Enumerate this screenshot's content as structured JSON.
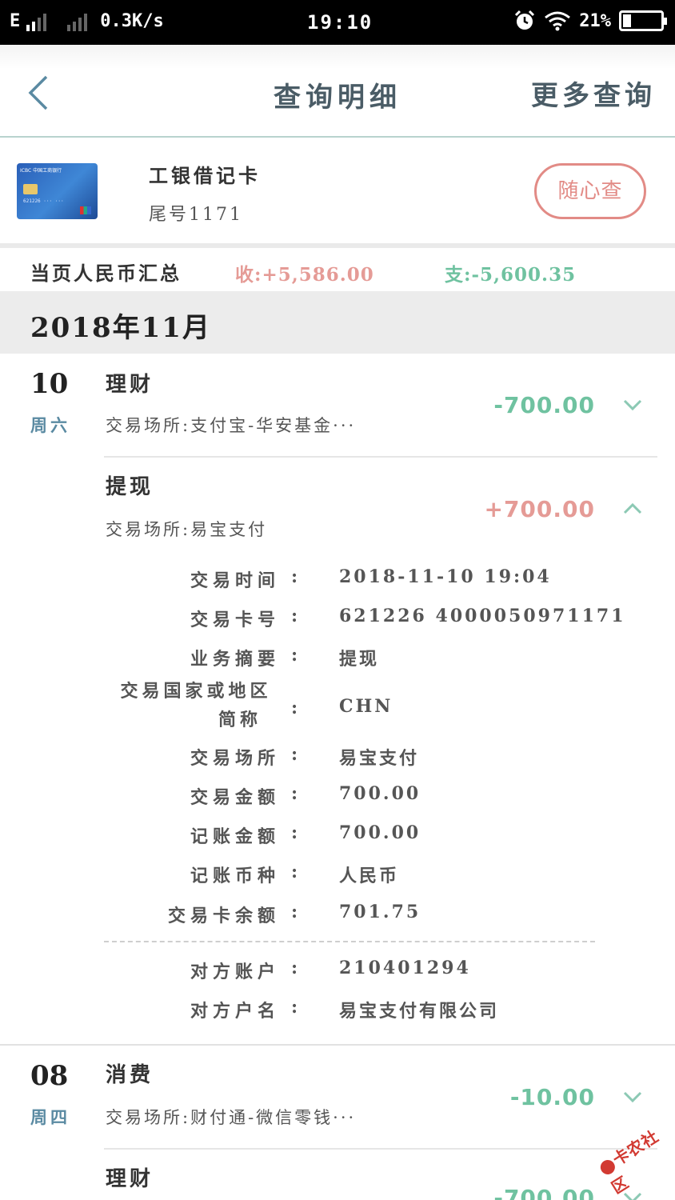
{
  "status_bar": {
    "network": "E",
    "speed": "0.3K/s",
    "time": "19:10",
    "battery": "21%",
    "battery_level": 0.21
  },
  "nav": {
    "title": "查询明细",
    "more": "更多查询"
  },
  "card": {
    "name": "工银借记卡",
    "tail": "尾号1171",
    "query_button": "随心查"
  },
  "summary": {
    "label": "当页人民币汇总",
    "income": "收:+5,586.00",
    "expense": "支:-5,600.35"
  },
  "month": "2018年11月",
  "transactions": [
    {
      "day": "10",
      "weekday": "周六",
      "type": "理财",
      "place": "交易场所:支付宝-华安基金···",
      "amount": "-700.00"
    },
    {
      "type": "提现",
      "place": "交易场所:易宝支付",
      "amount": "+700.00",
      "details": [
        {
          "label": "交易时间",
          "value": "2018-11-10 19:04"
        },
        {
          "label": "交易卡号",
          "value": "621226 4000050971171"
        },
        {
          "label": "业务摘要",
          "value": "提现"
        },
        {
          "label": "交易国家或地区简称",
          "label_line1": "交易国家或地区",
          "label_line2": "简称",
          "value": "CHN"
        },
        {
          "label": "交易场所",
          "value": "易宝支付"
        },
        {
          "label": "交易金额",
          "value": "700.00"
        },
        {
          "label": "记账金额",
          "value": "700.00"
        },
        {
          "label": "记账币种",
          "value": "人民币"
        },
        {
          "label": "交易卡余额",
          "value": "701.75"
        },
        {
          "label": "对方账户",
          "value": "210401294"
        },
        {
          "label": "对方户名",
          "value": "易宝支付有限公司"
        }
      ],
      "colon": ":"
    },
    {
      "day": "08",
      "weekday": "周四",
      "type": "消费",
      "place": "交易场所:财付通-微信零钱···",
      "amount": "-10.00"
    },
    {
      "type": "理财",
      "amount": "-700.00"
    }
  ],
  "watermark": "卡农社区",
  "colors": {
    "income": "#e59b96",
    "expense": "#6fc2a0",
    "nav_text": "#4a5c66",
    "weekday": "#5a8aa2"
  }
}
